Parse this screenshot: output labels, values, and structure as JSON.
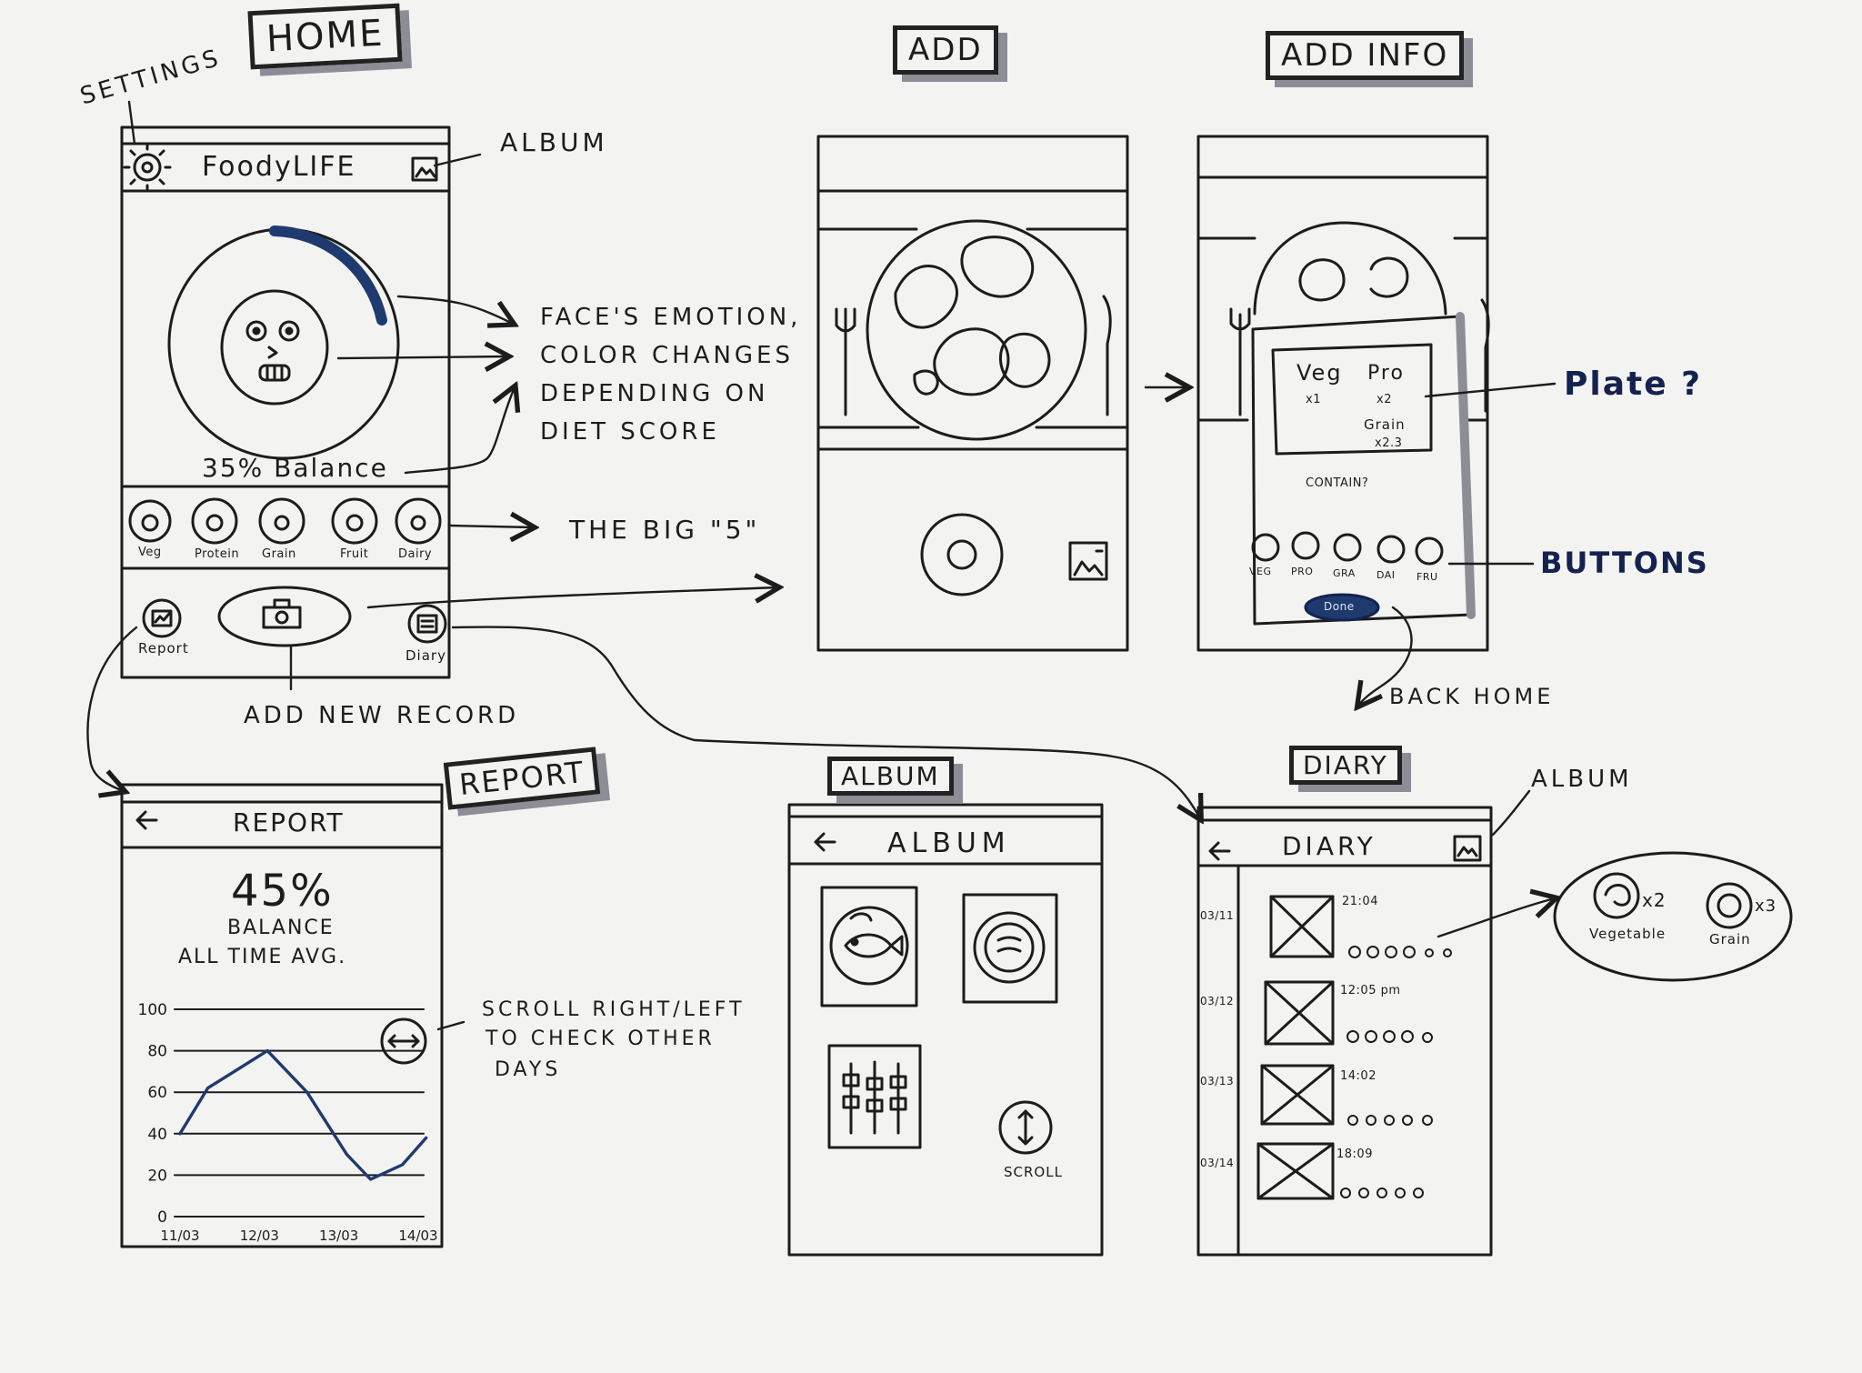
{
  "titles": {
    "home": "HOME",
    "add": "ADD",
    "add_info": "ADD INFO",
    "report": "REPORT",
    "album": "ALBUM",
    "diary": "DIARY"
  },
  "home": {
    "settings_note": "SETTINGS",
    "app_title": "FoodyLIFE",
    "album_note": "ALBUM",
    "balance": "35% Balance",
    "food_groups": [
      "Veg",
      "Protein",
      "Grain",
      "Fruit",
      "Dairy"
    ],
    "nav": {
      "report": "Report",
      "diary": "Diary"
    },
    "add_note": "ADD NEW RECORD",
    "emotion_note": [
      "FACE'S EMOTION,",
      "COLOR CHANGES",
      "DEPENDING ON",
      "DIET SCORE"
    ],
    "big5_note": "THE BIG \"5\""
  },
  "add_info": {
    "plate": {
      "veg": "Veg",
      "veg_count": "x1",
      "pro": "Pro",
      "pro_count": "x2",
      "grain": "Grain",
      "grain_count": "x2.3"
    },
    "contain": "CONTAIN?",
    "buttons": [
      "VEG",
      "PRO",
      "GRA",
      "DAI",
      "FRU"
    ],
    "done": "Done",
    "plate_note": "Plate ?",
    "buttons_note": "BUTTONS",
    "back_note": "BACK HOME"
  },
  "report": {
    "screen_title": "REPORT",
    "percent": "45%",
    "balance": "BALANCE",
    "avg": "ALL TIME AVG.",
    "scroll_note": [
      "SCROLL RIGHT/LEFT",
      "TO CHECK OTHER",
      "DAYS"
    ]
  },
  "chart_data": {
    "type": "line",
    "x": [
      "11/03",
      "12/03",
      "13/03",
      "14/03"
    ],
    "y_ticks": [
      "0",
      "20",
      "40",
      "60",
      "80",
      "100"
    ],
    "ylim": [
      0,
      100
    ],
    "points": [
      [
        0,
        40
      ],
      [
        0.35,
        62
      ],
      [
        1.1,
        80
      ],
      [
        1.6,
        60
      ],
      [
        2.1,
        30
      ],
      [
        2.4,
        18
      ],
      [
        2.8,
        25
      ],
      [
        3.1,
        38
      ]
    ]
  },
  "album": {
    "screen_title": "ALBUM",
    "scroll": "SCROLL"
  },
  "diary": {
    "screen_title": "DIARY",
    "album_note": "ALBUM",
    "entries": [
      {
        "date": "03/11",
        "time": "21:04"
      },
      {
        "date": "03/12",
        "time": "12:05 pm"
      },
      {
        "date": "03/13",
        "time": "14:02"
      },
      {
        "date": "03/14",
        "time": "18:09"
      }
    ],
    "detail": {
      "veg": "Vegetable",
      "veg_count": "x2",
      "grain": "Grain",
      "grain_count": "x3"
    }
  },
  "colors": {
    "ink": "#1c1c1c",
    "accent": "#1f3a6e",
    "shadow": "#8d8d96"
  }
}
